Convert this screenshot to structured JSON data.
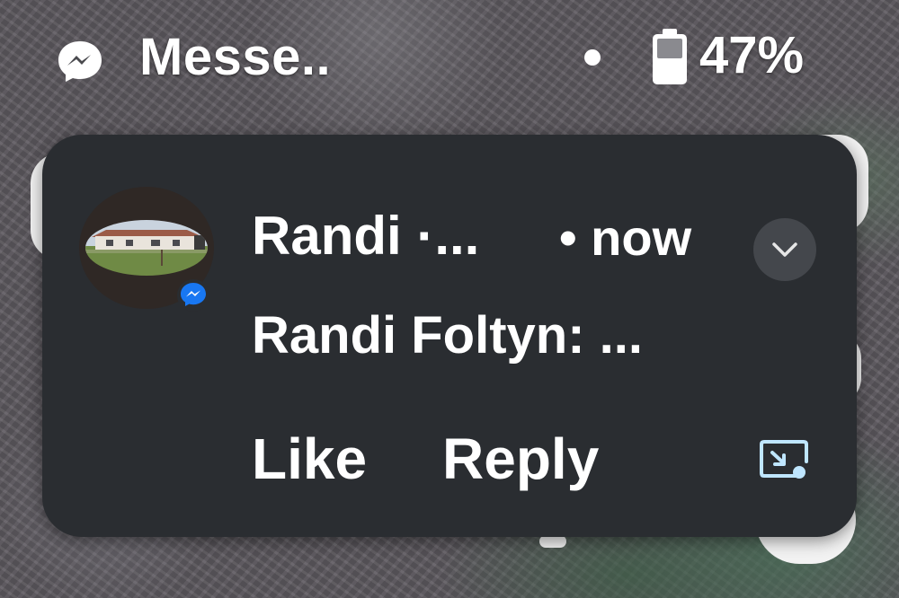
{
  "status_bar": {
    "app_name": "Messe..",
    "app_icon": "messenger-icon",
    "notification_dot": "dot-icon",
    "battery_icon": "battery-icon",
    "battery_percent": "47%"
  },
  "notification": {
    "sender": "Randi ·...",
    "timestamp": "• now",
    "message": "Randi Foltyn: ...",
    "avatar_badge_icon": "messenger-badge-icon",
    "expand_icon": "chevron-down-icon",
    "actions": {
      "like_label": "Like",
      "reply_label": "Reply"
    },
    "bubble_icon": "open-in-bubble-icon"
  },
  "colors": {
    "card_background": "#2a2d31",
    "text": "#ffffff",
    "expand_button_bg": "#44474c",
    "messenger_blue": "#1877f2",
    "bubble_icon_color": "#bfe6ff"
  }
}
